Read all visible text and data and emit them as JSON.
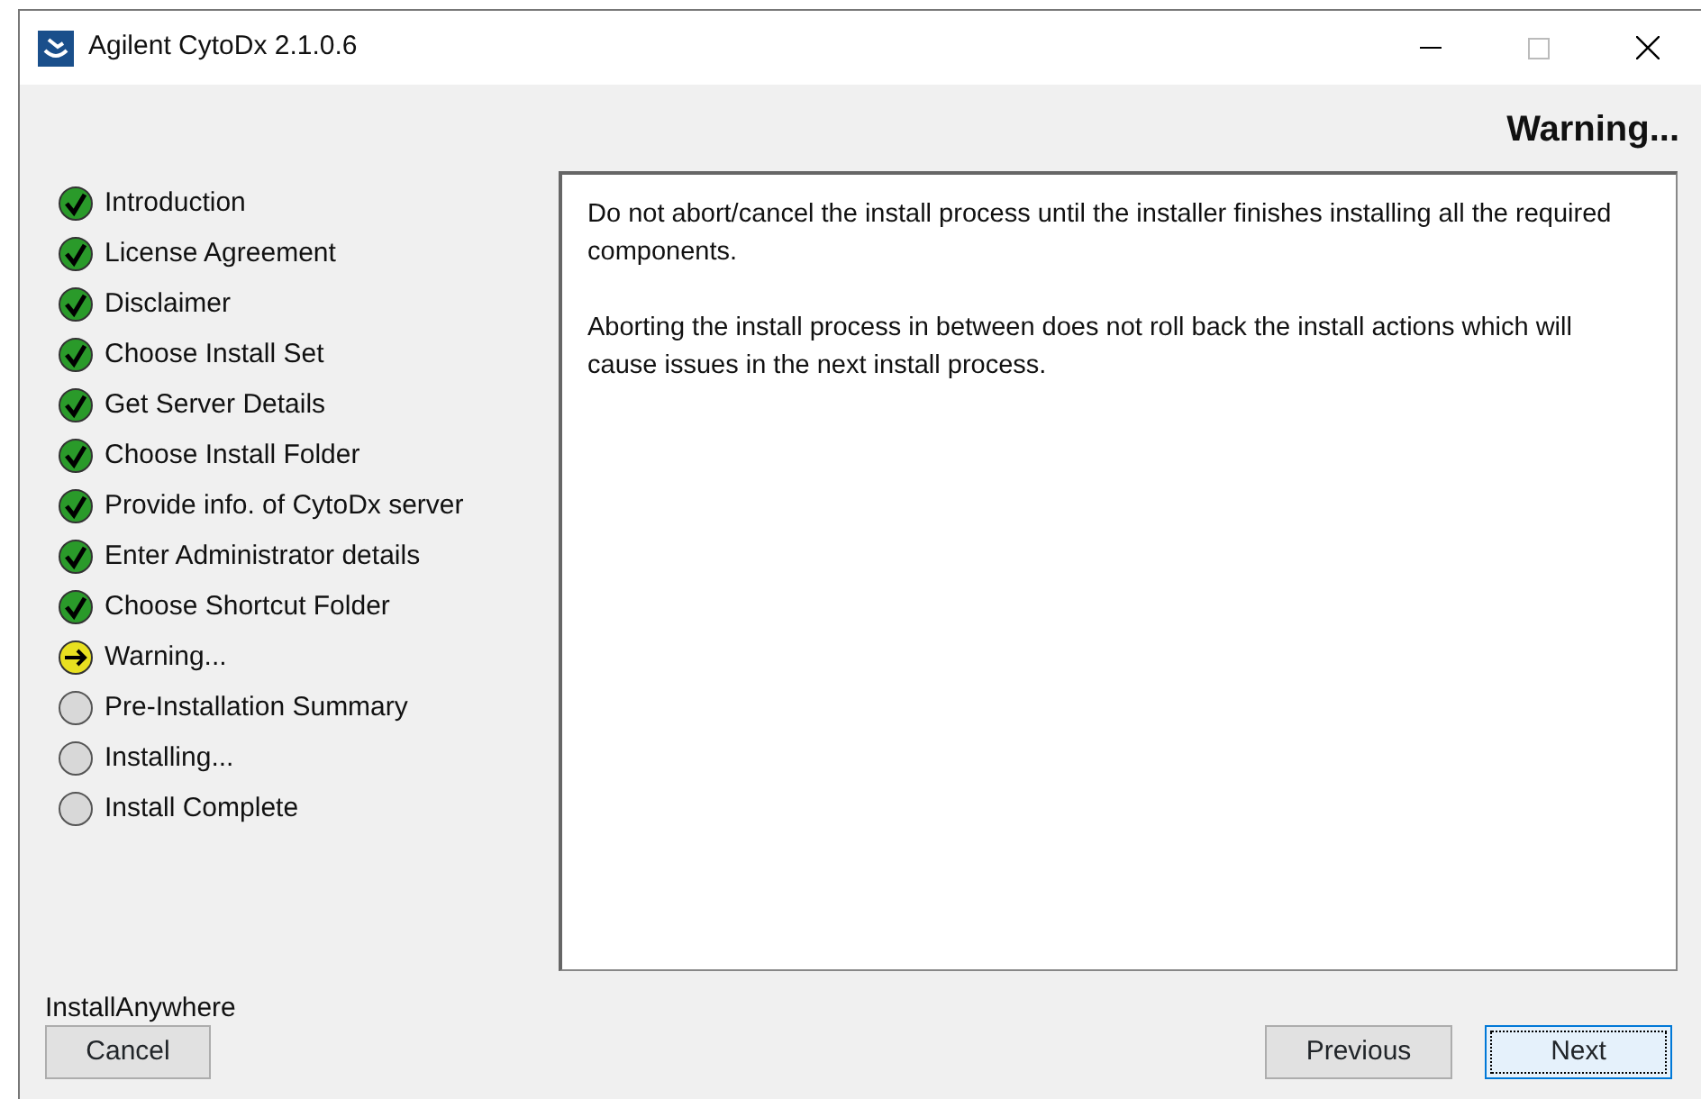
{
  "window": {
    "title": "Agilent CytoDx 2.1.0.6",
    "maximize_disabled": true
  },
  "heading": "Warning...",
  "steps": [
    {
      "label": "Introduction",
      "kind": "done"
    },
    {
      "label": "License Agreement",
      "kind": "done"
    },
    {
      "label": "Disclaimer",
      "kind": "done"
    },
    {
      "label": "Choose Install Set",
      "kind": "done"
    },
    {
      "label": "Get Server Details",
      "kind": "done"
    },
    {
      "label": "Choose Install Folder",
      "kind": "done"
    },
    {
      "label": "Provide info. of CytoDx server",
      "kind": "done"
    },
    {
      "label": "Enter Administrator details",
      "kind": "done"
    },
    {
      "label": "Choose Shortcut Folder",
      "kind": "done"
    },
    {
      "label": "Warning...",
      "kind": "current"
    },
    {
      "label": "Pre-Installation Summary",
      "kind": "pending"
    },
    {
      "label": "Installing...",
      "kind": "pending"
    },
    {
      "label": "Install Complete",
      "kind": "pending"
    }
  ],
  "message": [
    "Do not abort/cancel the install process until the installer finishes installing all the required components.",
    "Aborting the install process in between does not roll back the install actions which will cause issues in the next install process."
  ],
  "brand": "InstallAnywhere",
  "buttons": [
    {
      "label": "Cancel",
      "focused": false
    },
    {
      "label": "Previous",
      "focused": false
    },
    {
      "label": "Next",
      "focused": true
    }
  ]
}
